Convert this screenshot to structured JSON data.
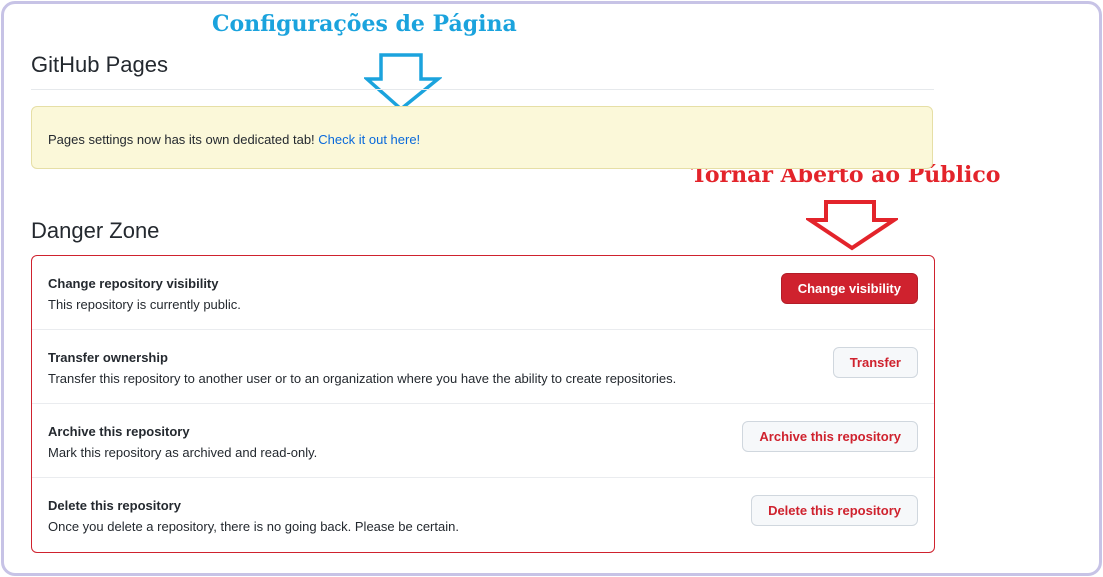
{
  "annotations": {
    "pages_label": "Configurações de  Página",
    "pages_color": "#1ba3dd",
    "public_label": "Tornar Aberto ao  Público",
    "public_color": "#e3242b"
  },
  "github_pages": {
    "heading": "GitHub Pages",
    "flash_text": "Pages settings now has its own dedicated tab! ",
    "flash_link": "Check it out here!"
  },
  "danger_zone": {
    "heading": "Danger Zone",
    "accent": "#cf222e",
    "rows": [
      {
        "title": "Change repository visibility",
        "description": "This repository is currently public.",
        "button": "Change visibility"
      },
      {
        "title": "Transfer ownership",
        "description": "Transfer this repository to another user or to an organization where you have the ability to create repositories.",
        "button": "Transfer"
      },
      {
        "title": "Archive this repository",
        "description": "Mark this repository as archived and read-only.",
        "button": "Archive this repository"
      },
      {
        "title": "Delete this repository",
        "description": "Once you delete a repository, there is no going back. Please be certain.",
        "button": "Delete this repository"
      }
    ]
  }
}
